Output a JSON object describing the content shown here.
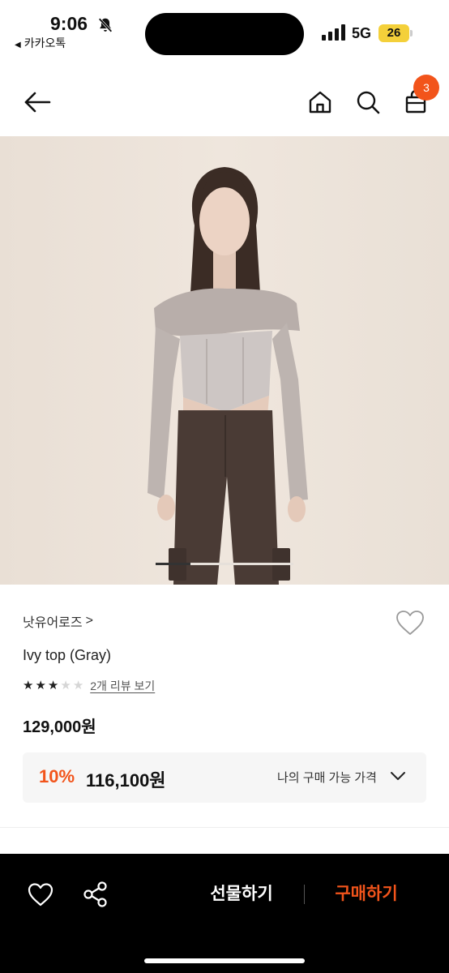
{
  "status_bar": {
    "time": "9:06",
    "back_app": "카카오톡",
    "network": "5G",
    "battery": "26"
  },
  "header": {
    "cart_count": "3",
    "icons": [
      "back-arrow-icon",
      "home-icon",
      "search-icon",
      "shopping-bag-icon"
    ]
  },
  "gallery": {
    "image_alt": "product photo",
    "current_index_fraction": 0.25
  },
  "product": {
    "brand": "낫유어로즈",
    "brand_chevron": ">",
    "name": "Ivy top (Gray)",
    "rating": 3,
    "rating_max": 5,
    "review_link": "2개 리뷰 보기",
    "list_price": "129,000원",
    "discount": "10%",
    "sale_price": "116,100원",
    "my_price_label": "나의 구매 가능 가격"
  },
  "bottom_bar": {
    "gift_label": "선물하기",
    "buy_label": "구매하기"
  },
  "colors": {
    "accent": "#f2541b",
    "bottom_bar_bg": "#000000"
  }
}
